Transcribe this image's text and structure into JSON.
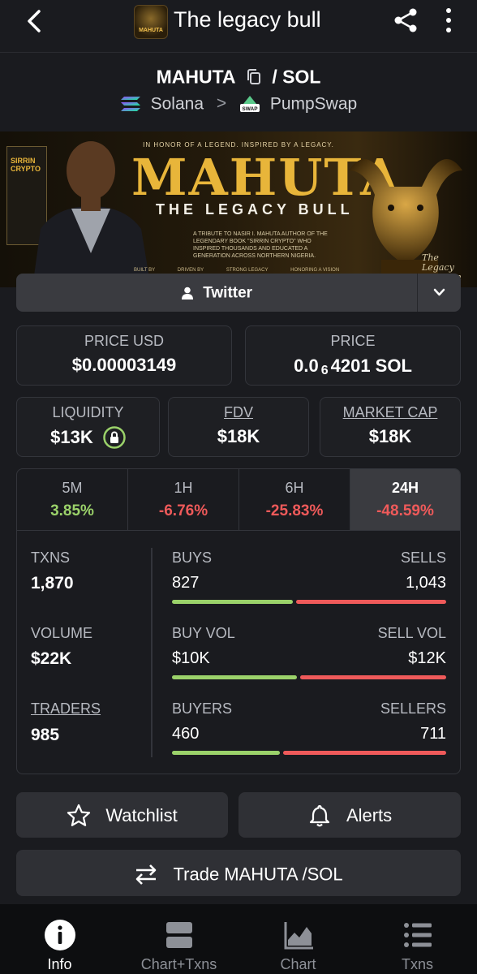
{
  "app": {
    "title": "The legacy bull",
    "logo_text": "MAHUTA"
  },
  "pair": {
    "base": "MAHUTA",
    "quote": "/ SOL",
    "chain": "Solana",
    "separator": ">",
    "dex": "PumpSwap",
    "dex_badge": "SWAP"
  },
  "banner": {
    "tagline": "IN HONOR OF A LEGEND. INSPIRED BY A LEGACY.",
    "title": "MAHUTA",
    "subtitle": "THE LEGACY BULL",
    "tribute": "A TRIBUTE TO NASIR I. MAHUTA AUTHOR OF THE LEGENDARY BOOK \"SIRRIN CRYPTO\" WHO INSPIRED THOUSANDS AND EDUCATED A GENERATION ACROSS NORTHERN NIGERIA.",
    "book_title": "SIRRIN CRYPTO",
    "footer": [
      "BUILT BY",
      "DRIVEN BY",
      "STRONG LEGACY",
      "HONORING A VISION"
    ],
    "cursive": "The Legacy Lives On"
  },
  "social": {
    "label": "Twitter"
  },
  "price": {
    "usd_label": "PRICE USD",
    "usd_value": "$0.00003149",
    "native_label": "PRICE",
    "native_prefix": "0.0",
    "native_zeros": "6",
    "native_suffix": "4201 SOL"
  },
  "metrics": {
    "liquidity_label": "LIQUIDITY",
    "liquidity_value": "$13K",
    "fdv_label": "FDV",
    "fdv_value": "$18K",
    "mcap_label": "MARKET CAP",
    "mcap_value": "$18K"
  },
  "timeframes": [
    {
      "label": "5M",
      "value": "3.85%",
      "direction": "up"
    },
    {
      "label": "1H",
      "value": "-6.76%",
      "direction": "down"
    },
    {
      "label": "6H",
      "value": "-25.83%",
      "direction": "down"
    },
    {
      "label": "24H",
      "value": "-48.59%",
      "direction": "down",
      "active": true
    }
  ],
  "stats": {
    "txns_label": "TXNS",
    "txns_value": "1,870",
    "volume_label": "VOLUME",
    "volume_value": "$22K",
    "traders_label": "TRADERS",
    "traders_value": "985",
    "buys_label": "BUYS",
    "buys_value": "827",
    "sells_label": "SELLS",
    "sells_value": "1,043",
    "buy_vol_label": "BUY VOL",
    "buy_vol_value": "$10K",
    "sell_vol_label": "SELL VOL",
    "sell_vol_value": "$12K",
    "buyers_label": "BUYERS",
    "buyers_value": "460",
    "sellers_label": "SELLERS",
    "sellers_value": "711",
    "buy_share_txns": 0.442,
    "buy_share_vol": 0.455,
    "buy_share_traders": 0.393
  },
  "actions": {
    "watchlist": "Watchlist",
    "alerts": "Alerts",
    "trade": "Trade MAHUTA /SOL"
  },
  "nav": [
    {
      "label": "Info",
      "icon": "info-icon",
      "active": true
    },
    {
      "label": "Chart+Txns",
      "icon": "chart-txns-icon"
    },
    {
      "label": "Chart",
      "icon": "chart-icon"
    },
    {
      "label": "Txns",
      "icon": "txns-icon"
    }
  ],
  "colors": {
    "positive": "#9bd26a",
    "negative": "#ef5a5a",
    "background": "#1a1b1f",
    "gold": "#e8b53a"
  }
}
